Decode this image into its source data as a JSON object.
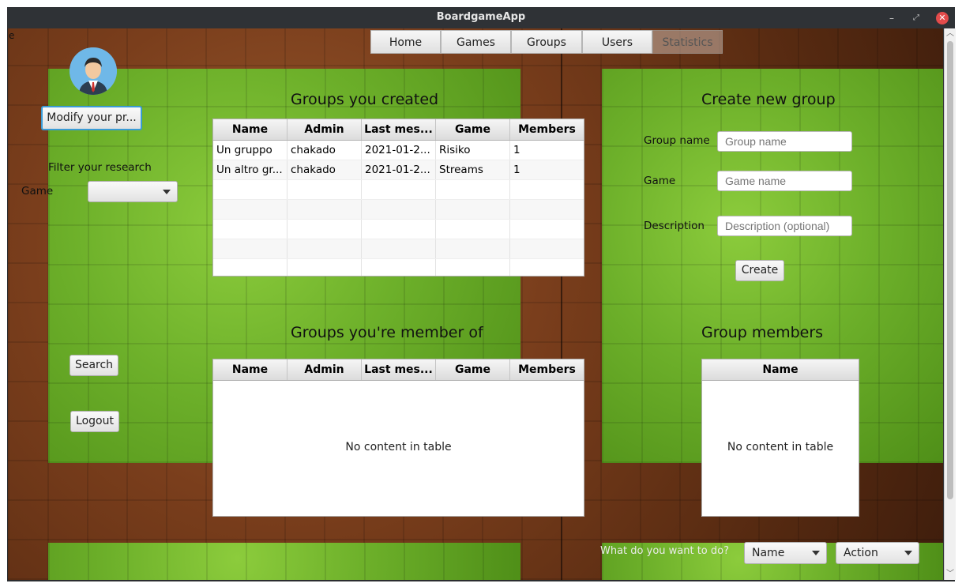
{
  "window": {
    "title": "BoardgameApp"
  },
  "nav": {
    "tabs": [
      "Home",
      "Games",
      "Groups",
      "Users",
      "Statistics"
    ],
    "active": "Statistics"
  },
  "sidebar": {
    "modify_profile": "Modify your pr...",
    "filter_label": "Filter your research",
    "game_label": "Game",
    "game_select": "",
    "search_button": "Search",
    "logout_button": "Logout",
    "edge_char": "e"
  },
  "created_groups": {
    "heading": "Groups you created",
    "columns": [
      "Name",
      "Admin",
      "Last mes...",
      "Game",
      "Members"
    ],
    "rows": [
      [
        "Un gruppo",
        "chakado",
        "2021-01-2...",
        "Risiko",
        "1"
      ],
      [
        "Un altro gr...",
        "chakado",
        "2021-01-2...",
        "Streams",
        "1"
      ]
    ]
  },
  "member_groups": {
    "heading": "Groups you're member of",
    "columns": [
      "Name",
      "Admin",
      "Last mes...",
      "Game",
      "Members"
    ],
    "empty_text": "No content in table"
  },
  "create_group": {
    "heading": "Create new group",
    "group_name_label": "Group name",
    "group_name_placeholder": "Group name",
    "game_label": "Game",
    "game_placeholder": "Game name",
    "description_label": "Description",
    "description_placeholder": "Description (optional)",
    "create_button": "Create"
  },
  "group_members": {
    "heading": "Group members",
    "columns": [
      "Name"
    ],
    "empty_text": "No content in table"
  },
  "actions": {
    "prompt": "What do you want to do?",
    "name_select": "Name",
    "action_select": "Action"
  },
  "colors": {
    "focus": "#3a9bd6",
    "close": "#e34b4b"
  }
}
